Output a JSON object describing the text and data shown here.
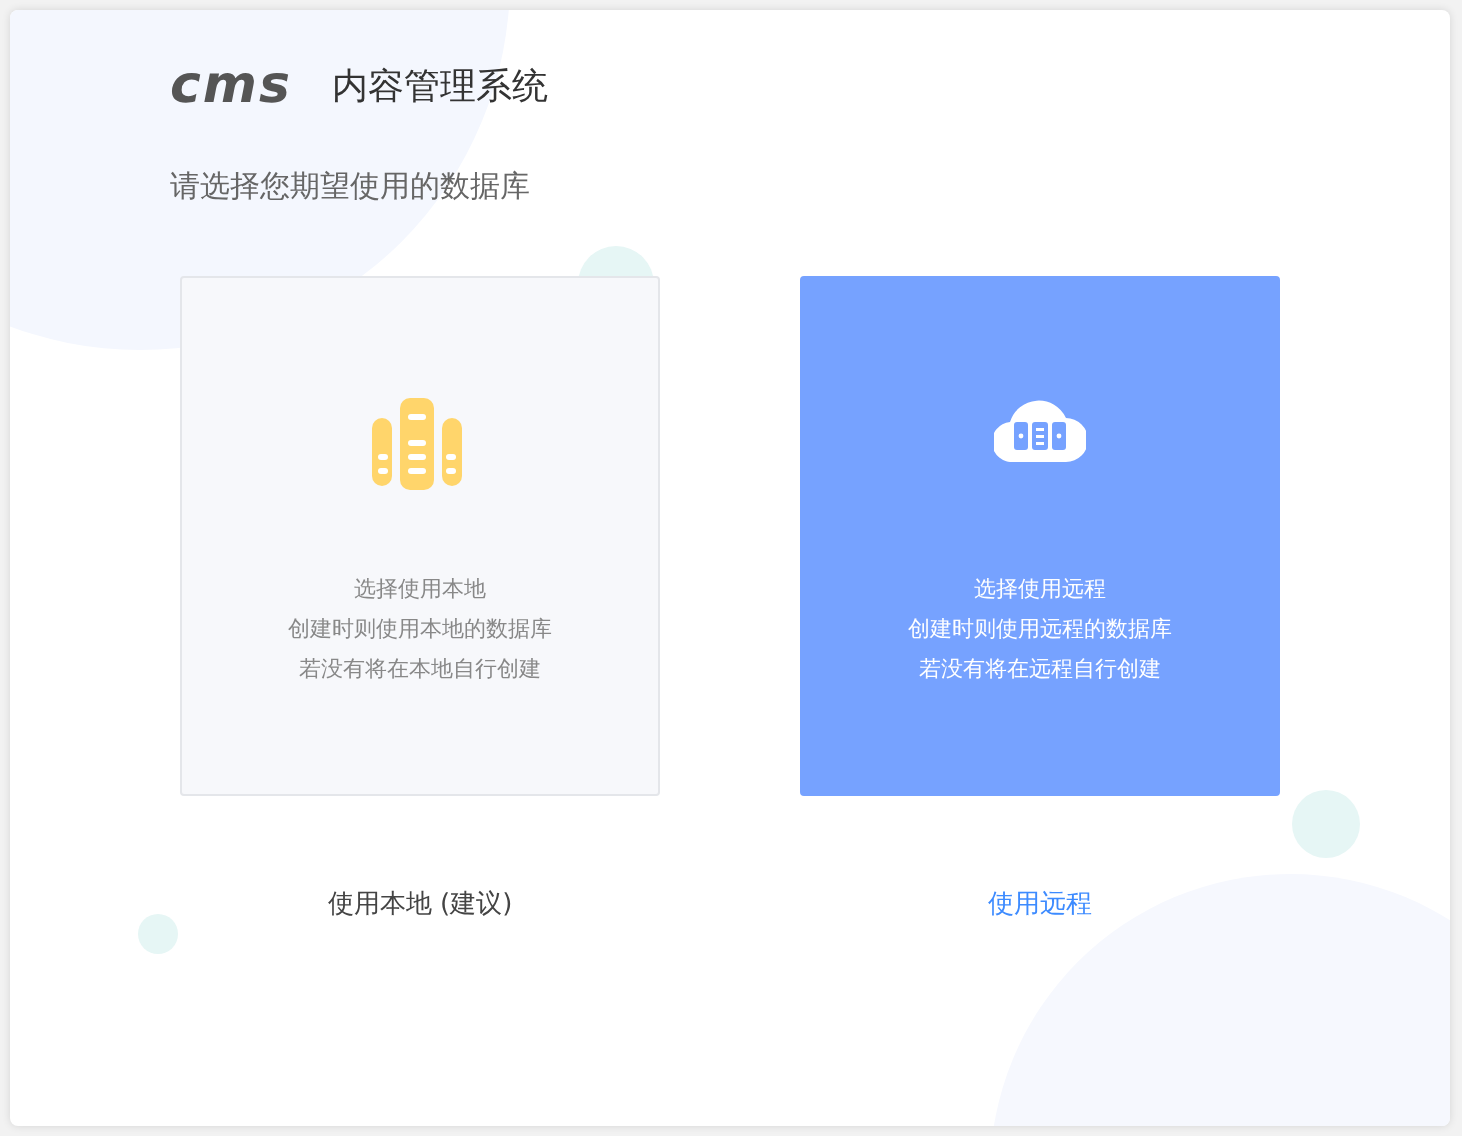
{
  "header": {
    "logo": "cms",
    "title": "内容管理系统"
  },
  "prompt": "请选择您期望使用的数据库",
  "options": [
    {
      "kind": "local",
      "selected": false,
      "lines": [
        "选择使用本地",
        "创建时则使用本地的数据库",
        "若没有将在本地自行创建"
      ],
      "action": "使用本地 (建议)"
    },
    {
      "kind": "remote",
      "selected": true,
      "lines": [
        "选择使用远程",
        "创建时则使用远程的数据库",
        "若没有将在远程自行创建"
      ],
      "action": "使用远程"
    }
  ]
}
